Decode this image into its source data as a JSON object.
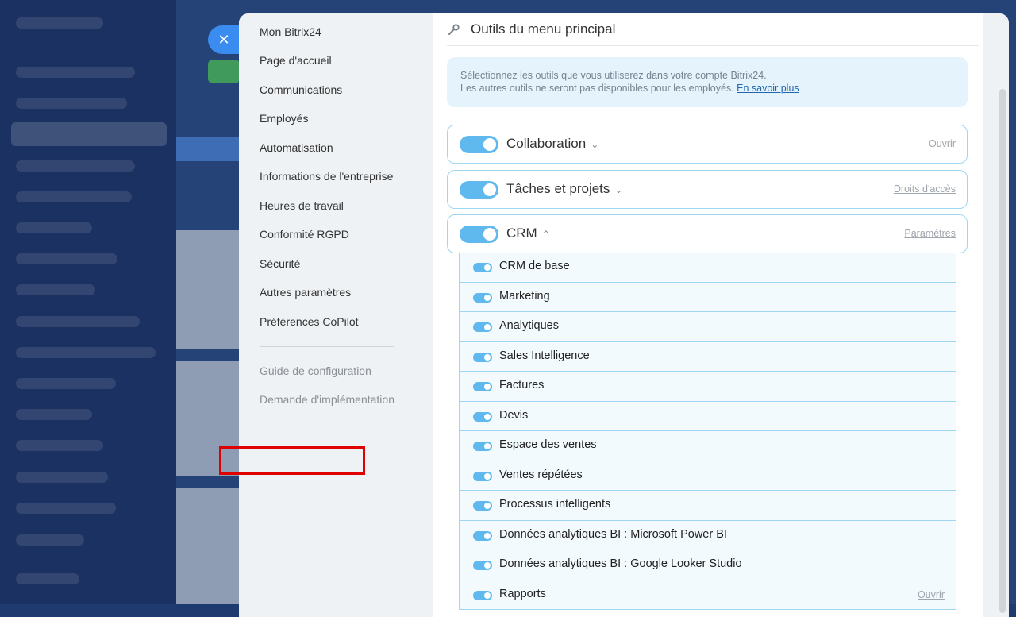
{
  "modal": {
    "close_icon": "close-icon",
    "nav_items": [
      "Mon Bitrix24",
      "Page d'accueil",
      "Communications",
      "Employés",
      "Automatisation",
      "Informations de l'entreprise",
      "Heures de travail",
      "Conformité RGPD",
      "Sécurité",
      "Autres paramètres",
      "Préférences CoPilot"
    ],
    "nav_secondary": [
      "Guide de configuration",
      "Demande d'implémentation"
    ]
  },
  "content": {
    "header_icon": "wrench-icon",
    "title": "Outils du menu principal",
    "info_line1": "Sélectionnez les outils que vous utiliserez dans votre compte Bitrix24.",
    "info_line2": "Les autres outils ne seront pas disponibles pour les employés.",
    "info_link": "En savoir plus",
    "sections": [
      {
        "name": "Collaboration",
        "chevron": "⌄",
        "link": "Ouvrir",
        "enabled": true
      },
      {
        "name": "Tâches et projets",
        "chevron": "⌄",
        "link": "Droits d'accès",
        "enabled": true
      },
      {
        "name": "CRM",
        "chevron": "⌃",
        "link": "Paramètres",
        "enabled": true
      }
    ],
    "crm_items": [
      {
        "label": "CRM de base",
        "enabled": true
      },
      {
        "label": "Marketing",
        "enabled": true
      },
      {
        "label": "Analytiques",
        "enabled": true
      },
      {
        "label": "Sales Intelligence",
        "enabled": true
      },
      {
        "label": "Factures",
        "enabled": true
      },
      {
        "label": "Devis",
        "enabled": true
      },
      {
        "label": "Espace des ventes",
        "enabled": true
      },
      {
        "label": "Ventes répétées",
        "enabled": true
      },
      {
        "label": "Processus intelligents",
        "enabled": true
      },
      {
        "label": "Données analytiques BI : Microsoft Power BI",
        "enabled": true
      },
      {
        "label": "Données analytiques BI : Google Looker Studio",
        "enabled": true
      },
      {
        "label": "Rapports",
        "enabled": true,
        "link": "Ouvrir"
      }
    ],
    "highlighted_item": "Ventes répétées"
  },
  "colors": {
    "accent": "#5fb9ef",
    "border": "#9fd6f2",
    "highlight": "#e00000",
    "link": "#2067b0"
  }
}
